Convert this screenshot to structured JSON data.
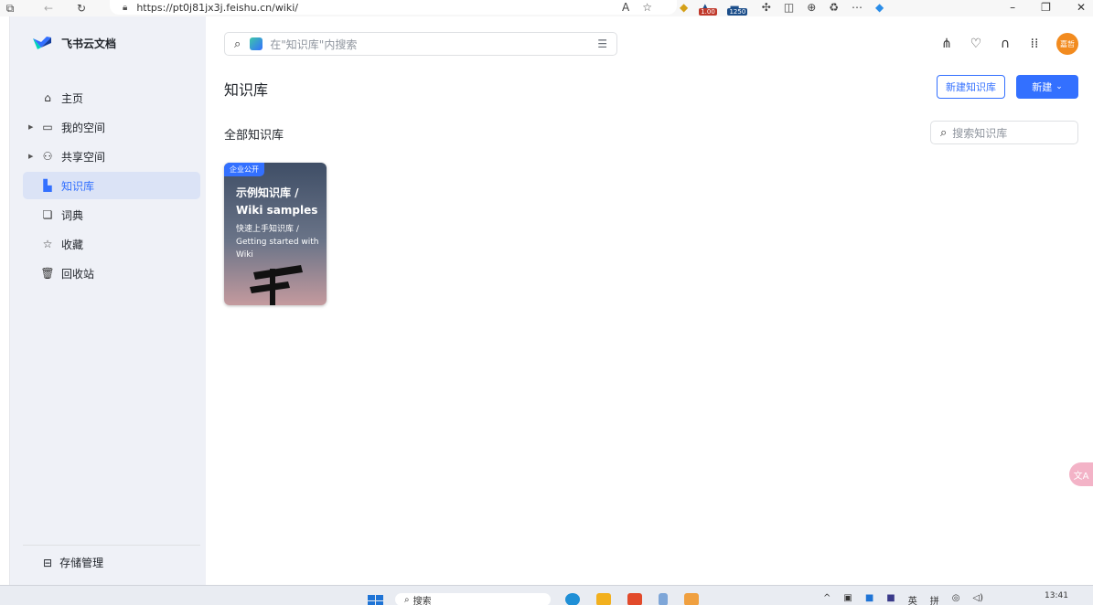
{
  "browser": {
    "url": "https://pt0j81jx3j.feishu.cn/wiki/",
    "badges": [
      "1.00",
      "1250"
    ]
  },
  "app": {
    "name": "飞书云文档"
  },
  "sidebar": {
    "items": [
      {
        "label": "主页",
        "icon": "home-icon",
        "has_arrow": false,
        "active": false
      },
      {
        "label": "我的空间",
        "icon": "folder-icon",
        "has_arrow": true,
        "active": false
      },
      {
        "label": "共享空间",
        "icon": "people-icon",
        "has_arrow": true,
        "active": false
      },
      {
        "label": "知识库",
        "icon": "wiki-icon",
        "has_arrow": false,
        "active": true
      },
      {
        "label": "词典",
        "icon": "dictionary-icon",
        "has_arrow": false,
        "active": false
      },
      {
        "label": "收藏",
        "icon": "star-icon",
        "has_arrow": false,
        "active": false
      },
      {
        "label": "回收站",
        "icon": "trash-icon",
        "has_arrow": false,
        "active": false
      }
    ],
    "storage_label": "存储管理"
  },
  "header": {
    "search_placeholder": "在\"知识库\"内搜索",
    "avatar_text": "嘉哲"
  },
  "main": {
    "title": "知识库",
    "new_wiki_button": "新建知识库",
    "new_button": "新建",
    "section_title": "全部知识库",
    "wiki_search_placeholder": "搜索知识库",
    "cards": [
      {
        "tag": "企业公开",
        "title": "示例知识库 / Wiki samples",
        "subtitle": "快速上手知识库 / Getting started with Wiki"
      }
    ]
  },
  "taskbar": {
    "search_label": "搜索",
    "time": "13:41",
    "lang": "英"
  },
  "colors": {
    "accent": "#3370ff",
    "sidebar_bg": "#eff1f7",
    "avatar": "#f28b1f"
  }
}
